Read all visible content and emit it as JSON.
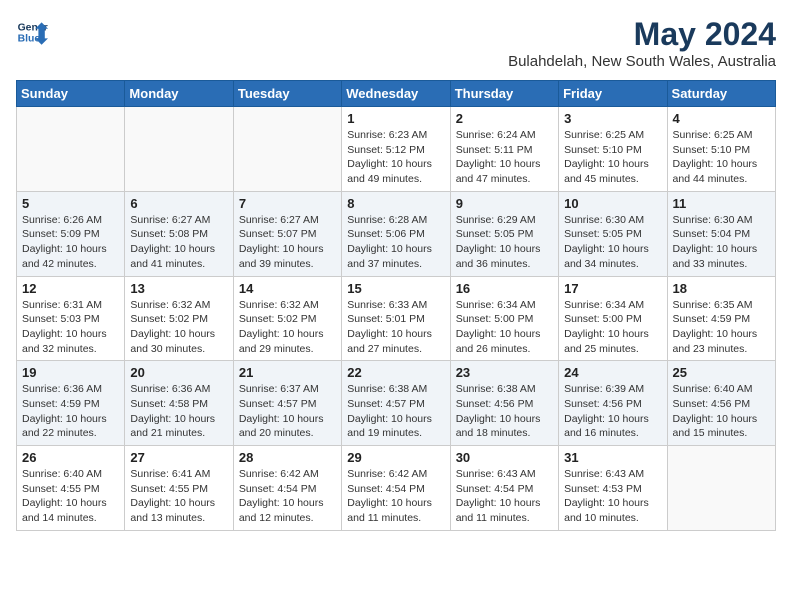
{
  "header": {
    "logo_line1": "General",
    "logo_line2": "Blue",
    "title": "May 2024",
    "subtitle": "Bulahdelah, New South Wales, Australia"
  },
  "weekdays": [
    "Sunday",
    "Monday",
    "Tuesday",
    "Wednesday",
    "Thursday",
    "Friday",
    "Saturday"
  ],
  "rows": [
    [
      {
        "day": "",
        "details": ""
      },
      {
        "day": "",
        "details": ""
      },
      {
        "day": "",
        "details": ""
      },
      {
        "day": "1",
        "details": "Sunrise: 6:23 AM\nSunset: 5:12 PM\nDaylight: 10 hours\nand 49 minutes."
      },
      {
        "day": "2",
        "details": "Sunrise: 6:24 AM\nSunset: 5:11 PM\nDaylight: 10 hours\nand 47 minutes."
      },
      {
        "day": "3",
        "details": "Sunrise: 6:25 AM\nSunset: 5:10 PM\nDaylight: 10 hours\nand 45 minutes."
      },
      {
        "day": "4",
        "details": "Sunrise: 6:25 AM\nSunset: 5:10 PM\nDaylight: 10 hours\nand 44 minutes."
      }
    ],
    [
      {
        "day": "5",
        "details": "Sunrise: 6:26 AM\nSunset: 5:09 PM\nDaylight: 10 hours\nand 42 minutes."
      },
      {
        "day": "6",
        "details": "Sunrise: 6:27 AM\nSunset: 5:08 PM\nDaylight: 10 hours\nand 41 minutes."
      },
      {
        "day": "7",
        "details": "Sunrise: 6:27 AM\nSunset: 5:07 PM\nDaylight: 10 hours\nand 39 minutes."
      },
      {
        "day": "8",
        "details": "Sunrise: 6:28 AM\nSunset: 5:06 PM\nDaylight: 10 hours\nand 37 minutes."
      },
      {
        "day": "9",
        "details": "Sunrise: 6:29 AM\nSunset: 5:05 PM\nDaylight: 10 hours\nand 36 minutes."
      },
      {
        "day": "10",
        "details": "Sunrise: 6:30 AM\nSunset: 5:05 PM\nDaylight: 10 hours\nand 34 minutes."
      },
      {
        "day": "11",
        "details": "Sunrise: 6:30 AM\nSunset: 5:04 PM\nDaylight: 10 hours\nand 33 minutes."
      }
    ],
    [
      {
        "day": "12",
        "details": "Sunrise: 6:31 AM\nSunset: 5:03 PM\nDaylight: 10 hours\nand 32 minutes."
      },
      {
        "day": "13",
        "details": "Sunrise: 6:32 AM\nSunset: 5:02 PM\nDaylight: 10 hours\nand 30 minutes."
      },
      {
        "day": "14",
        "details": "Sunrise: 6:32 AM\nSunset: 5:02 PM\nDaylight: 10 hours\nand 29 minutes."
      },
      {
        "day": "15",
        "details": "Sunrise: 6:33 AM\nSunset: 5:01 PM\nDaylight: 10 hours\nand 27 minutes."
      },
      {
        "day": "16",
        "details": "Sunrise: 6:34 AM\nSunset: 5:00 PM\nDaylight: 10 hours\nand 26 minutes."
      },
      {
        "day": "17",
        "details": "Sunrise: 6:34 AM\nSunset: 5:00 PM\nDaylight: 10 hours\nand 25 minutes."
      },
      {
        "day": "18",
        "details": "Sunrise: 6:35 AM\nSunset: 4:59 PM\nDaylight: 10 hours\nand 23 minutes."
      }
    ],
    [
      {
        "day": "19",
        "details": "Sunrise: 6:36 AM\nSunset: 4:59 PM\nDaylight: 10 hours\nand 22 minutes."
      },
      {
        "day": "20",
        "details": "Sunrise: 6:36 AM\nSunset: 4:58 PM\nDaylight: 10 hours\nand 21 minutes."
      },
      {
        "day": "21",
        "details": "Sunrise: 6:37 AM\nSunset: 4:57 PM\nDaylight: 10 hours\nand 20 minutes."
      },
      {
        "day": "22",
        "details": "Sunrise: 6:38 AM\nSunset: 4:57 PM\nDaylight: 10 hours\nand 19 minutes."
      },
      {
        "day": "23",
        "details": "Sunrise: 6:38 AM\nSunset: 4:56 PM\nDaylight: 10 hours\nand 18 minutes."
      },
      {
        "day": "24",
        "details": "Sunrise: 6:39 AM\nSunset: 4:56 PM\nDaylight: 10 hours\nand 16 minutes."
      },
      {
        "day": "25",
        "details": "Sunrise: 6:40 AM\nSunset: 4:56 PM\nDaylight: 10 hours\nand 15 minutes."
      }
    ],
    [
      {
        "day": "26",
        "details": "Sunrise: 6:40 AM\nSunset: 4:55 PM\nDaylight: 10 hours\nand 14 minutes."
      },
      {
        "day": "27",
        "details": "Sunrise: 6:41 AM\nSunset: 4:55 PM\nDaylight: 10 hours\nand 13 minutes."
      },
      {
        "day": "28",
        "details": "Sunrise: 6:42 AM\nSunset: 4:54 PM\nDaylight: 10 hours\nand 12 minutes."
      },
      {
        "day": "29",
        "details": "Sunrise: 6:42 AM\nSunset: 4:54 PM\nDaylight: 10 hours\nand 11 minutes."
      },
      {
        "day": "30",
        "details": "Sunrise: 6:43 AM\nSunset: 4:54 PM\nDaylight: 10 hours\nand 11 minutes."
      },
      {
        "day": "31",
        "details": "Sunrise: 6:43 AM\nSunset: 4:53 PM\nDaylight: 10 hours\nand 10 minutes."
      },
      {
        "day": "",
        "details": ""
      }
    ]
  ]
}
